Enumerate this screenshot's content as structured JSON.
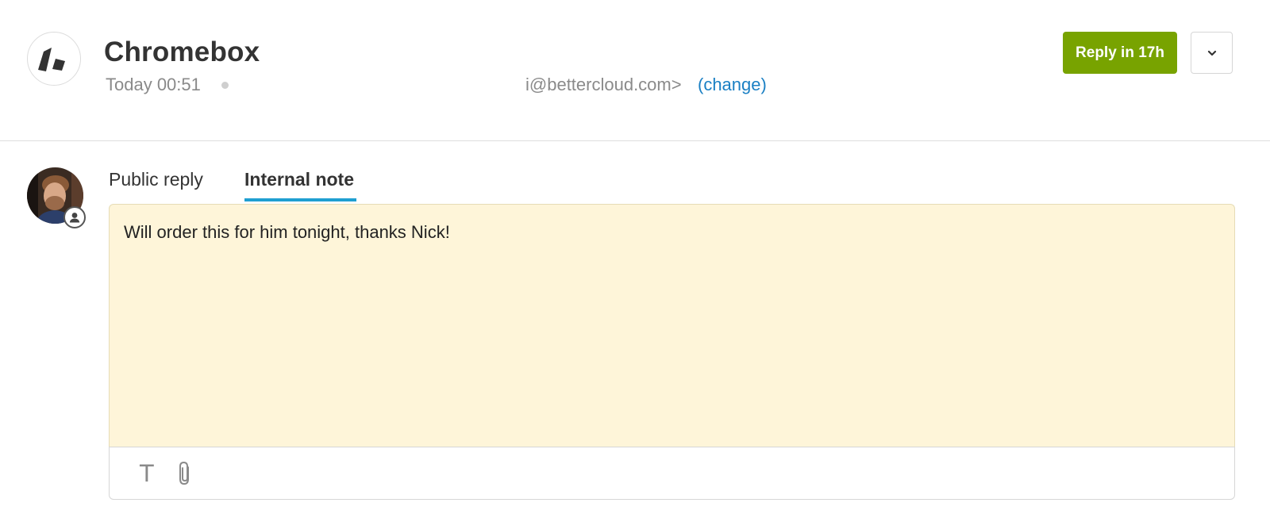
{
  "header": {
    "title": "Chromebox",
    "timestamp": "Today 00:51",
    "from_address": "i@bettercloud.com>",
    "change_link": "(change)",
    "reply_button": "Reply in 17h",
    "logo_icon": "zendesk-logo-icon",
    "options_icon": "chevron-down-icon"
  },
  "composer": {
    "tabs": [
      {
        "label": "Public reply",
        "active": false
      },
      {
        "label": "Internal note",
        "active": true
      }
    ],
    "note_text": "Will order this for him tonight, thanks Nick!",
    "toolbar": {
      "format_icon_glyph": "T",
      "format_icon": "text-format-icon",
      "attach_icon": "paperclip-icon"
    }
  },
  "colors": {
    "reply_button": "#78a300",
    "link": "#1b80c4",
    "active_tab_underline": "#1f9fd1",
    "note_background": "#fef5d9"
  }
}
